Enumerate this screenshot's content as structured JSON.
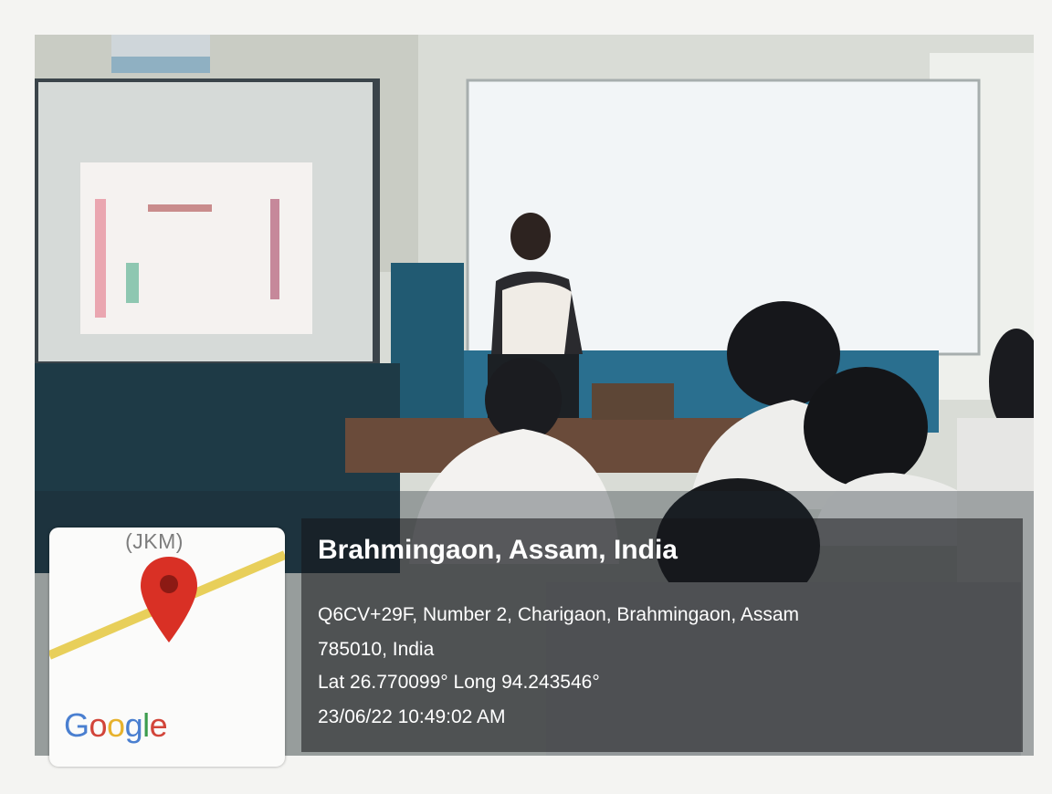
{
  "map": {
    "place_label": "(JKM)",
    "logo_letters": [
      "G",
      "o",
      "o",
      "g",
      "l",
      "e"
    ],
    "logo_colors": [
      "#4a7fd0",
      "#d2453a",
      "#e7b22c",
      "#4a7fd0",
      "#3c9c4e",
      "#d2453a"
    ],
    "pin_color": "#d93025",
    "road_color": "#e8cf5a"
  },
  "overlay": {
    "location_title": "Brahmingaon, Assam, India",
    "address_line1": "Q6CV+29F, Number 2, Charigaon, Brahmingaon, Assam",
    "address_line2": "785010, India",
    "coordinates": "Lat 26.770099° Long 94.243546°",
    "timestamp": "23/06/22 10:49:02 AM"
  }
}
